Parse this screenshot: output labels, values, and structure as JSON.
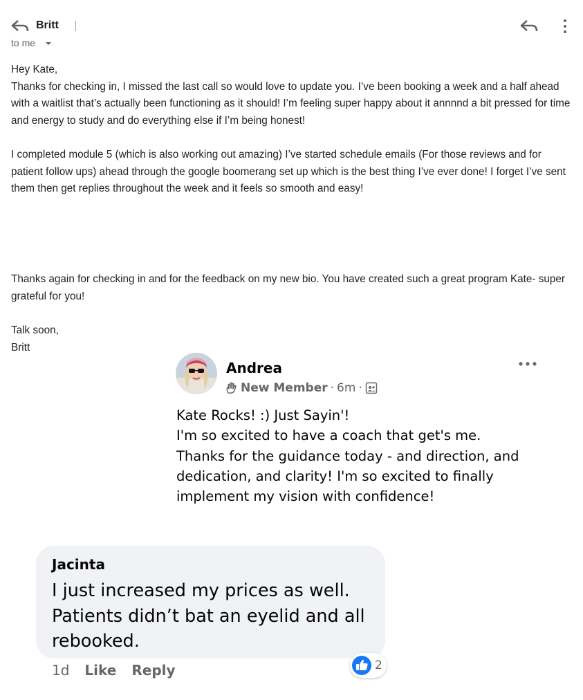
{
  "email": {
    "sender": "Britt",
    "recipient": "to me",
    "icons": {
      "back": "back-arrow-icon",
      "reply": "reply-icon",
      "more": "more-vertical-icon"
    },
    "paragraphs": [
      "Hey Kate,",
      "Thanks for checking in, I missed the last call so would love to update you. I’ve been booking a week and a half ahead with a waitlist that’s actually been functioning as it should! I’m feeling super happy about it annnnd a bit pressed for time and energy to study and do everything else if I’m being honest!",
      "I completed module 5 (which is also working out amazing) I’ve started schedule emails (For those reviews and for patient follow ups) ahead through the google boomerang set up which is the best thing I’ve ever done! I forget I’ve sent them then get replies throughout the week and it feels so smooth and easy!",
      "Thanks again for checking in and for the feedback on my new bio. You have created such a great program Kate- super grateful for you!",
      "Talk soon,",
      "Britt"
    ]
  },
  "post": {
    "author": "Andrea",
    "badge": "New Member",
    "time": "6m",
    "separator": "·",
    "audience_icon": "group-audience-icon",
    "lines": [
      "Kate Rocks! :) Just Sayin'!",
      "I'm so excited to have a coach that get's me.",
      "Thanks for the guidance today - and direction, and",
      "dedication, and clarity! I'm so excited to finally",
      "implement my vision with confidence!"
    ]
  },
  "comment": {
    "author": "Jacinta",
    "text": "I just increased my prices as well. Patients didn’t bat an eyelid and all rebooked.",
    "time": "1d",
    "like_label": "Like",
    "reply_label": "Reply",
    "reaction_count": "2",
    "reaction_icon": "like-thumb-icon"
  },
  "colors": {
    "comment_bubble": "#f0f2f5",
    "like_blue": "#1877f2",
    "meta_gray": "#65676b"
  }
}
